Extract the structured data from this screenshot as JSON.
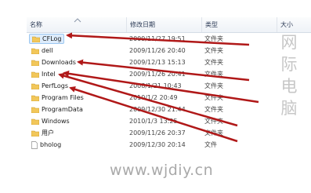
{
  "columns": {
    "name": "名称",
    "date": "修改日期",
    "type": "类型",
    "size": "大小"
  },
  "rows": [
    {
      "name": "CFLog",
      "date": "2009/11/27 19:51",
      "type": "文件夹",
      "icon": "folder-icon",
      "selected": true
    },
    {
      "name": "dell",
      "date": "2009/11/26 20:40",
      "type": "文件夹",
      "icon": "folder-icon"
    },
    {
      "name": "Downloads",
      "date": "2009/12/13 15:13",
      "type": "文件夹",
      "icon": "folder-icon"
    },
    {
      "name": "Intel",
      "date": "2009/11/26 20:41",
      "type": "文件夹",
      "icon": "folder-icon"
    },
    {
      "name": "PerfLogs",
      "date": "2008/1/21 10:43",
      "type": "文件夹",
      "icon": "folder-icon"
    },
    {
      "name": "Program Files",
      "date": "2010/1/2 20:49",
      "type": "文件夹",
      "icon": "folder-icon"
    },
    {
      "name": "ProgramData",
      "date": "2009/12/30 21:44",
      "type": "文件夹",
      "icon": "folder-icon"
    },
    {
      "name": "Windows",
      "date": "2010/1/3 13:25",
      "type": "文件夹",
      "icon": "folder-icon"
    },
    {
      "name": "用户",
      "date": "2009/11/26 20:37",
      "type": "文件夹",
      "icon": "folder-icon"
    },
    {
      "name": "bholog",
      "date": "2009/12/30 20:14",
      "type": "文件",
      "icon": "file-icon"
    }
  ],
  "watermark": {
    "chars": [
      "网",
      "际",
      "电",
      "脑"
    ]
  },
  "footer_url": "www.wjdiy.cn",
  "colors": {
    "arrow": "#b01818",
    "folder": "#f2c75a",
    "selection": "#ddecfc"
  }
}
